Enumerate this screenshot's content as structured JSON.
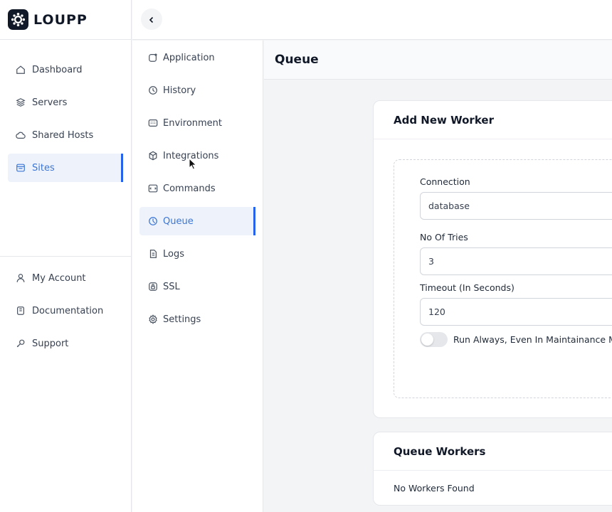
{
  "brand": {
    "name": "LOUPP"
  },
  "sidebar": {
    "items": [
      {
        "label": "Dashboard",
        "icon": "home-icon"
      },
      {
        "label": "Servers",
        "icon": "layers-icon"
      },
      {
        "label": "Shared Hosts",
        "icon": "cloud-icon"
      },
      {
        "label": "Sites",
        "icon": "browser-icon",
        "active": true
      }
    ],
    "bottom_items": [
      {
        "label": "My Account",
        "icon": "user-icon"
      },
      {
        "label": "Documentation",
        "icon": "book-icon"
      },
      {
        "label": "Support",
        "icon": "support-icon"
      }
    ]
  },
  "subnav": {
    "items": [
      {
        "label": "Application",
        "icon": "app-icon"
      },
      {
        "label": "History",
        "icon": "history-icon"
      },
      {
        "label": "Environment",
        "icon": "env-icon"
      },
      {
        "label": "Integrations",
        "icon": "cube-icon"
      },
      {
        "label": "Commands",
        "icon": "terminal-icon"
      },
      {
        "label": "Queue",
        "icon": "queue-icon",
        "active": true
      },
      {
        "label": "Logs",
        "icon": "logs-icon"
      },
      {
        "label": "SSL",
        "icon": "ssl-icon"
      },
      {
        "label": "Settings",
        "icon": "gear-icon"
      }
    ]
  },
  "main": {
    "title": "Queue",
    "add_worker": {
      "title": "Add New Worker",
      "connection": {
        "label": "Connection",
        "value": "database"
      },
      "tries": {
        "label": "No Of Tries",
        "value": "3"
      },
      "timeout": {
        "label": "Timeout (In Seconds)",
        "value": "120"
      },
      "run_always": {
        "label": "Run Always, Even In Maintainance Mode",
        "on": false
      }
    },
    "workers": {
      "title": "Queue Workers",
      "empty": "No Workers Found"
    }
  },
  "colors": {
    "accent": "#2563eb",
    "active_bg": "#eef3fb",
    "active_text": "#3b76d6"
  }
}
